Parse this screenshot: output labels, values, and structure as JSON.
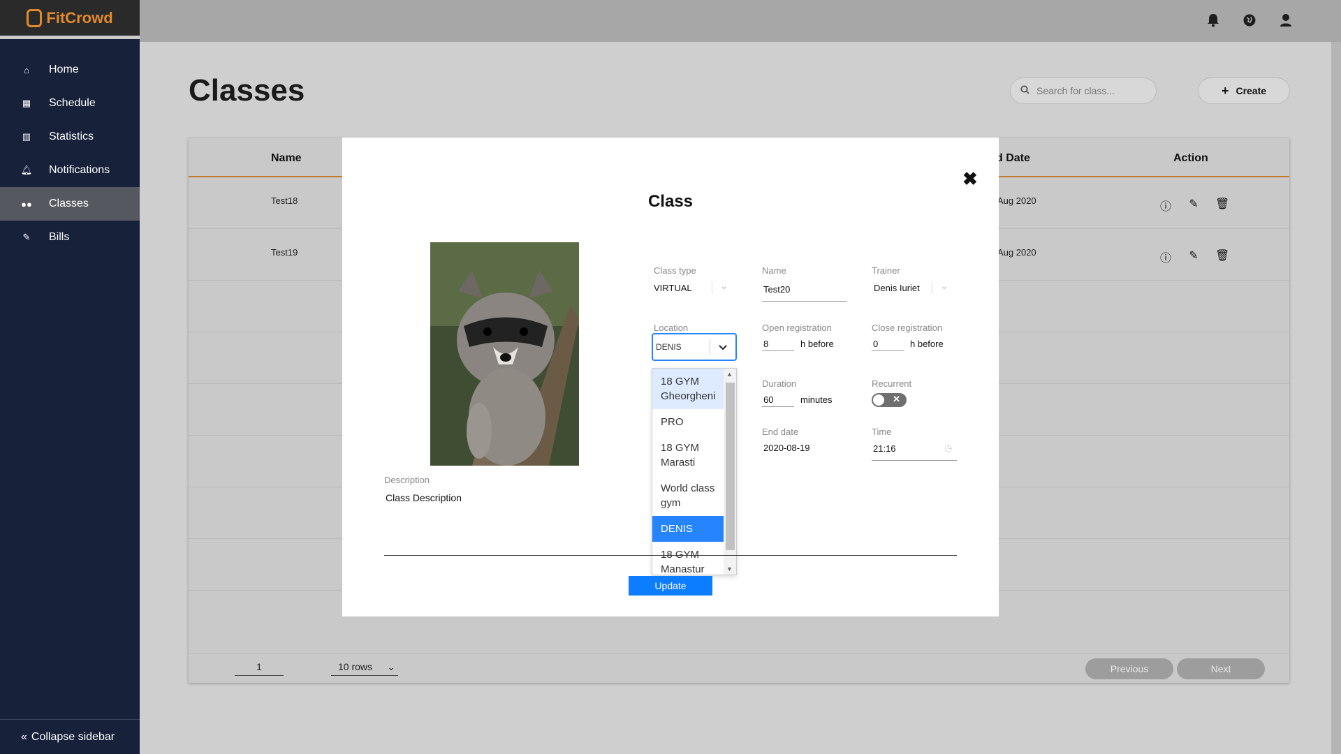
{
  "app": {
    "brand": "FitCrowd",
    "accent": "#e2892b"
  },
  "sidebar": {
    "items": [
      {
        "label": "Home",
        "icon": "home-icon"
      },
      {
        "label": "Schedule",
        "icon": "calendar-icon"
      },
      {
        "label": "Statistics",
        "icon": "bar-chart-icon"
      },
      {
        "label": "Notifications",
        "icon": "bell-icon"
      },
      {
        "label": "Classes",
        "icon": "users-icon",
        "active": true
      },
      {
        "label": "Bills",
        "icon": "paperclip-icon"
      }
    ],
    "collapse_label": "Collapse sidebar"
  },
  "page": {
    "title": "Classes",
    "search_placeholder": "Search for class...",
    "create_label": "Create"
  },
  "table": {
    "headers": {
      "name": "Name",
      "end_date": "d Date",
      "action": "Action"
    },
    "rows": [
      {
        "name": "Test18",
        "end_date": "Aug 2020"
      },
      {
        "name": "Test19",
        "end_date": "Aug 2020"
      }
    ],
    "footer": {
      "page": "1",
      "rows": "10 rows",
      "previous": "Previous",
      "next": "Next"
    }
  },
  "modal": {
    "title": "Class",
    "class_type": {
      "label": "Class type",
      "value": "VIRTUAL"
    },
    "name": {
      "label": "Name",
      "value": "Test20"
    },
    "trainer": {
      "label": "Trainer",
      "value": "Denis Iuriet"
    },
    "location": {
      "label": "Location",
      "value": "DENIS",
      "options": [
        "18 GYM Gheorgheni",
        "PRO",
        "18 GYM Marasti",
        "World class gym",
        "DENIS",
        "18 GYM Manastur"
      ],
      "hover_index": 0,
      "selected_index": 4
    },
    "open_registration": {
      "label": "Open registration",
      "value": "8",
      "suffix": "h before"
    },
    "close_registration": {
      "label": "Close registration",
      "value": "0",
      "suffix": "h before"
    },
    "duration": {
      "label": "Duration",
      "value": "60",
      "suffix": "minutes"
    },
    "recurrent": {
      "label": "Recurrent",
      "on": false
    },
    "end_date": {
      "label": "End date",
      "value": "2020-08-19"
    },
    "time": {
      "label": "Time",
      "value": "21:16"
    },
    "description": {
      "label": "Description",
      "value": "Class Description"
    },
    "update_label": "Update"
  }
}
